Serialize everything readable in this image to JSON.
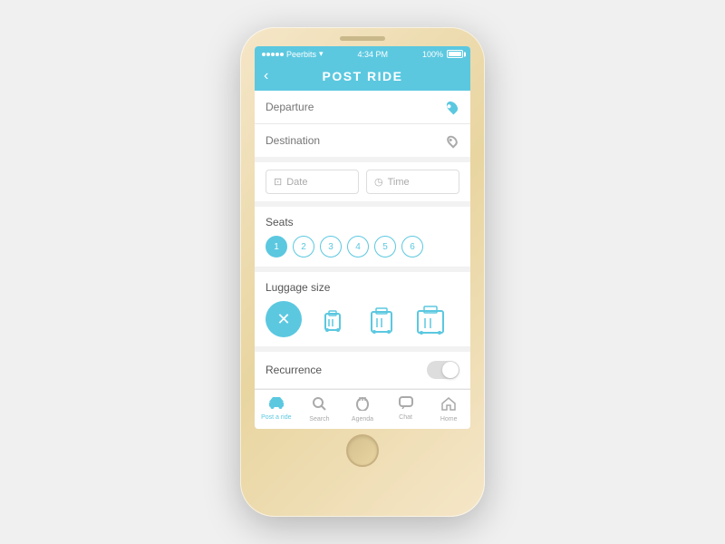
{
  "phone": {
    "status_bar": {
      "carrier": "Peerbits",
      "wifi": "wifi",
      "time": "4:34 PM",
      "battery": "100%"
    },
    "header": {
      "back_label": "‹",
      "title": "POST RIDE"
    },
    "form": {
      "departure_placeholder": "Departure",
      "destination_placeholder": "Destination",
      "date_placeholder": "Date",
      "time_placeholder": "Time",
      "seats_label": "Seats",
      "seats": [
        "1",
        "2",
        "3",
        "4",
        "5",
        "6"
      ],
      "active_seat": 0,
      "luggage_label": "Luggage size",
      "luggage_options": [
        "none",
        "small",
        "medium",
        "large"
      ],
      "active_luggage": 0,
      "recurrence_label": "Recurrence",
      "recurrence_on": false
    },
    "nav": {
      "items": [
        {
          "icon": "🚗",
          "label": "Post a ride",
          "active": true
        },
        {
          "icon": "🔍",
          "label": "Search",
          "active": false
        },
        {
          "icon": "🔔",
          "label": "Agenda",
          "active": false
        },
        {
          "icon": "💬",
          "label": "Chat",
          "active": false
        },
        {
          "icon": "🏠",
          "label": "Home",
          "active": false
        }
      ]
    }
  }
}
